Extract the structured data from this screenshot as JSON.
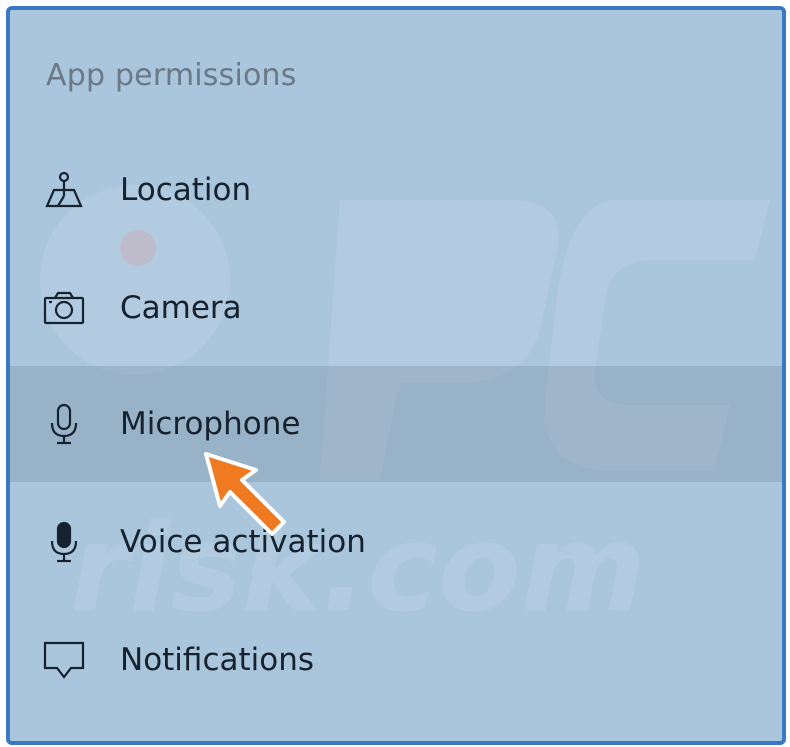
{
  "section_title": "App permissions",
  "items": [
    {
      "label": "Location",
      "icon": "location-icon",
      "selected": false
    },
    {
      "label": "Camera",
      "icon": "camera-icon",
      "selected": false
    },
    {
      "label": "Microphone",
      "icon": "microphone-icon",
      "selected": true
    },
    {
      "label": "Voice activation",
      "icon": "voice-activation-icon",
      "selected": false
    },
    {
      "label": "Notifications",
      "icon": "notifications-icon",
      "selected": false
    }
  ],
  "colors": {
    "panel_background": "#aac6dd",
    "frame_border": "#3a78c4",
    "selected_row": "#98afc2",
    "text": "#16222e",
    "section_title": "#6b7886",
    "arrow": "#f07a22"
  },
  "annotation": {
    "arrow_target": "Microphone",
    "arrow_icon": "pointer-arrow-icon"
  }
}
